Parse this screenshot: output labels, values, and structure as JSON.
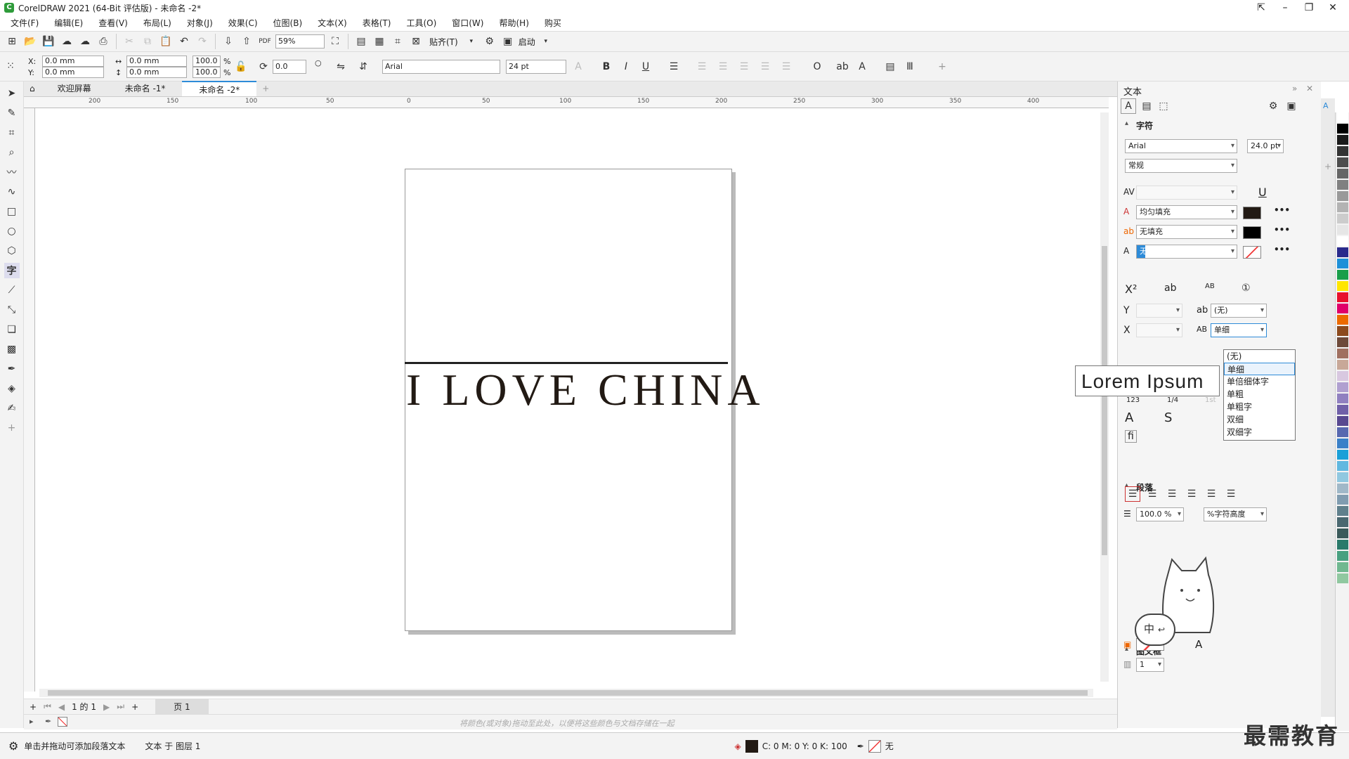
{
  "window": {
    "title": "CorelDRAW 2021 (64-Bit 评估版) - 未命名 -2*"
  },
  "menu": [
    "文件(F)",
    "编辑(E)",
    "查看(V)",
    "布局(L)",
    "对象(J)",
    "效果(C)",
    "位图(B)",
    "文本(X)",
    "表格(T)",
    "工具(O)",
    "窗口(W)",
    "帮助(H)",
    "购买"
  ],
  "toolbar": {
    "zoom": "59%",
    "snap_label": "贴齐(T)",
    "launch_label": "启动"
  },
  "props": {
    "x": "0.0 mm",
    "y": "0.0 mm",
    "w": "0.0 mm",
    "h": "0.0 mm",
    "scale_x": "100.0",
    "scale_y": "100.0",
    "pct": "%",
    "rotation": "0.0",
    "font": "Arial",
    "size": "24 pt"
  },
  "tabs": [
    "欢迎屏幕",
    "未命名 -1*",
    "未命名 -2*"
  ],
  "ruler_labels": [
    "200",
    "150",
    "100",
    "50",
    "0",
    "50",
    "100",
    "150",
    "200",
    "250",
    "300",
    "350",
    "400"
  ],
  "canvas": {
    "text": "I LOVE CHINA"
  },
  "pagebar": {
    "page_of": "1 的 1",
    "page_tab": "页 1"
  },
  "colorbar": {
    "hint": "将颜色(或对象)拖动至此处，以便将这些颜色与文档存储在一起"
  },
  "status": {
    "hint": "单击并拖动可添加段落文本",
    "layer": "文本 于 图层 1",
    "cmyk": "C: 0 M: 0 Y: 0 K: 100",
    "outline": "无"
  },
  "docker": {
    "title": "文本",
    "section_char": "字符",
    "font": "Arial",
    "size": "24.0 pt",
    "style": "常规",
    "fill1": "均匀填充",
    "fill2": "无填充",
    "outline": "无",
    "script_pos": "(无)",
    "underline_sel": "单细",
    "section_para": "段落",
    "line_spacing": "100.0 %",
    "spacing_unit": "%字符高度",
    "section_frame": "图文框",
    "frame_cols": "1",
    "nums": [
      "123",
      "1/4",
      "1st"
    ]
  },
  "underline_options": [
    "(无)",
    "单细",
    "单倍细体字",
    "单粗",
    "单粗字",
    "双细",
    "双细字"
  ],
  "tooltip": "Lorem Ipsum",
  "badge": {
    "lang": "中"
  },
  "watermark": "最需教育",
  "palette": [
    "#ffffff",
    "#000000",
    "#1a1a1a",
    "#333333",
    "#4d4d4d",
    "#666666",
    "#808080",
    "#999999",
    "#b3b3b3",
    "#cccccc",
    "#e6e6e6",
    "#ffffff",
    "#2a2a8c",
    "#1e90d8",
    "#1a9e4a",
    "#ffe600",
    "#e8112d",
    "#e0006a",
    "#ec6a00",
    "#8c4a1e",
    "#6e4a3a",
    "#a07060",
    "#c8a898",
    "#d8c8e0",
    "#b0a0d0",
    "#9080c0",
    "#7060a8",
    "#584890",
    "#5868b0",
    "#3a80c8",
    "#1aa0d8",
    "#60b8e0",
    "#90c8e0",
    "#a0b8c8",
    "#809cb0",
    "#60808c",
    "#4a6870",
    "#3a5a5a",
    "#2a7a6a",
    "#48a080",
    "#70b890",
    "#90c8a0"
  ]
}
